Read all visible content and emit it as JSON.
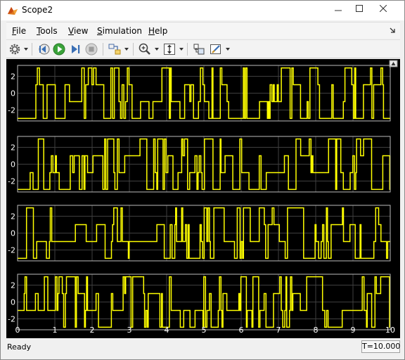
{
  "window": {
    "title": "Scope2",
    "controls": [
      "minimize",
      "maximize",
      "close"
    ]
  },
  "menu": {
    "items": [
      {
        "label": "File",
        "mnemonic": "F"
      },
      {
        "label": "Tools",
        "mnemonic": "T"
      },
      {
        "label": "View",
        "mnemonic": "V"
      },
      {
        "label": "Simulation",
        "mnemonic": "S"
      },
      {
        "label": "Help",
        "mnemonic": "H"
      }
    ]
  },
  "toolbar": {
    "buttons": [
      {
        "name": "settings-icon",
        "dropdown": true
      },
      {
        "name": "step-back-icon",
        "dropdown": false
      },
      {
        "name": "run-icon",
        "dropdown": false
      },
      {
        "name": "step-forward-icon",
        "dropdown": false
      },
      {
        "name": "stop-icon",
        "dropdown": false
      },
      {
        "name": "highlight-block-icon",
        "dropdown": true
      },
      {
        "name": "zoom-in-icon",
        "dropdown": true
      },
      {
        "name": "scale-axes-icon",
        "dropdown": true
      },
      {
        "name": "restore-view-icon",
        "dropdown": false
      },
      {
        "name": "measurements-icon",
        "dropdown": true
      }
    ]
  },
  "status": {
    "text": "Ready",
    "time": "T=10.000"
  },
  "chart_data": [
    {
      "type": "line",
      "step": true,
      "x_range": [
        0,
        10
      ],
      "ylim": [
        -3.3,
        3.3
      ],
      "yticks": [
        -2,
        0,
        2
      ],
      "grid": true,
      "color": "#ffff00",
      "levels": [
        -3,
        -1,
        1,
        3
      ],
      "seed": 7
    },
    {
      "type": "line",
      "step": true,
      "x_range": [
        0,
        10
      ],
      "ylim": [
        -3.3,
        3.3
      ],
      "yticks": [
        -2,
        0,
        2
      ],
      "grid": true,
      "color": "#ffff00",
      "levels": [
        -3,
        -1,
        1,
        3
      ],
      "seed": 19
    },
    {
      "type": "line",
      "step": true,
      "x_range": [
        0,
        10
      ],
      "ylim": [
        -3.3,
        3.3
      ],
      "yticks": [
        -2,
        0,
        2
      ],
      "grid": true,
      "color": "#ffff00",
      "levels": [
        -3,
        -1,
        1,
        3
      ],
      "seed": 31
    },
    {
      "type": "line",
      "step": true,
      "x_range": [
        0,
        10
      ],
      "ylim": [
        -3.3,
        3.3
      ],
      "yticks": [
        -2,
        0,
        2
      ],
      "grid": true,
      "color": "#ffff00",
      "levels": [
        -3,
        -1,
        1,
        3
      ],
      "seed": 47
    }
  ],
  "x_axis": {
    "ticks": [
      "0",
      "1",
      "2",
      "3",
      "4",
      "5",
      "6",
      "7",
      "8",
      "9",
      "10"
    ]
  },
  "colors": {
    "background": "#000000",
    "axes_border": "#bcbcbc",
    "grid": "#3f3f3f",
    "signal": "#ffff00",
    "text": "#ffffff"
  }
}
